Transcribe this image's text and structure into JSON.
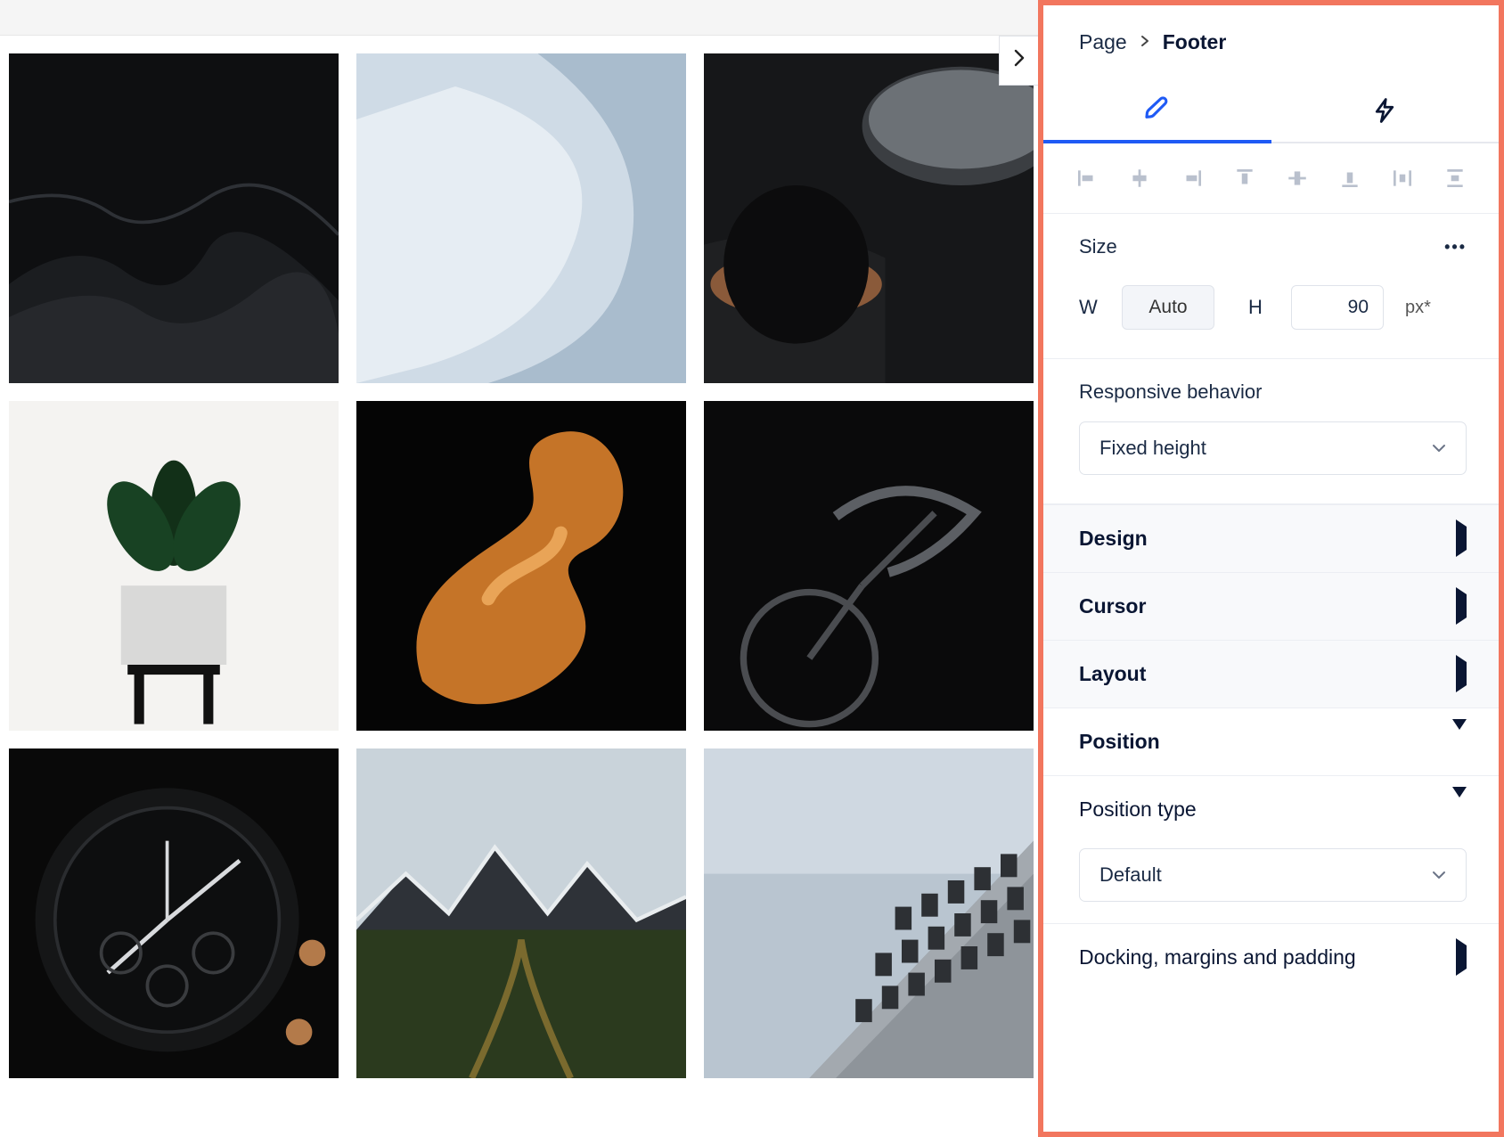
{
  "breadcrumb": {
    "parent": "Page",
    "current": "Footer"
  },
  "panel": {
    "size": {
      "title": "Size",
      "w_label": "W",
      "w_value": "Auto",
      "h_label": "H",
      "h_value": "90",
      "h_unit": "px*"
    },
    "responsive": {
      "title": "Responsive behavior",
      "value": "Fixed height"
    },
    "sections": {
      "design": "Design",
      "cursor": "Cursor",
      "layout": "Layout",
      "position": "Position",
      "position_type": "Position type",
      "position_type_value": "Default",
      "docking": "Docking, margins and padding"
    }
  }
}
